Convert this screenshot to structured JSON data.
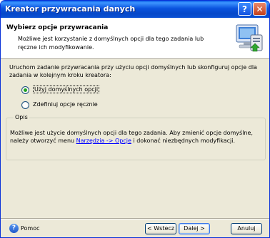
{
  "window": {
    "title": "Kreator przywracania danych",
    "help_button_glyph": "?",
    "close_button_glyph": "✕"
  },
  "header": {
    "title": "Wybierz opcje przywracania",
    "description": "Możliwe jest korzystanie z domyślnych opcji dla tego zadania lub ręczne ich modyfikowanie.",
    "icon": "wizard-computer-icon"
  },
  "content": {
    "instruction": "Uruchom zadanie przywracania przy użyciu opcji domyślnych lub skonfiguruj opcje dla zadania w kolejnym kroku kreatora:",
    "options": [
      {
        "label": "Użyj domyślnych opcji",
        "selected": true
      },
      {
        "label": "Zdefiniuj opcje ręcznie",
        "selected": false
      }
    ],
    "description_group": {
      "legend": "Opis",
      "text_before": "Możliwe jest użycie domyślnych opcji dla tego zadania. Aby zmienić opcje domyślne, należy otworzyć menu ",
      "link": "Narzędzia -> Opcje",
      "text_after": " i dokonać niezbędnych modyfikacji."
    }
  },
  "footer": {
    "help_label": "Pomoc",
    "help_icon": "help-circle-icon",
    "back_label": "< Wstecz",
    "next_label": "Dalej >",
    "cancel_label": "Anuluj"
  },
  "colors": {
    "titlebar": "#0a53de",
    "dialog_bg": "#ece9d8",
    "radio_dot": "#21a121",
    "link": "#0000ff"
  }
}
